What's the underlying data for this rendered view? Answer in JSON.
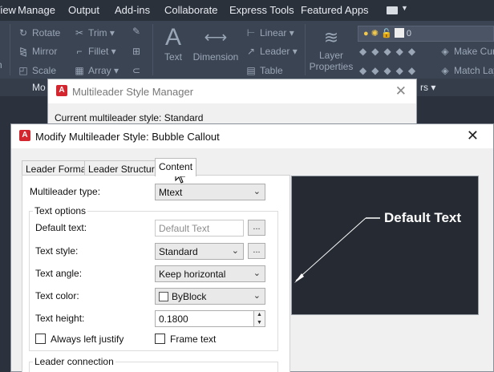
{
  "menubar": {
    "items": [
      "View",
      "Manage",
      "Output",
      "Add-ins",
      "Collaborate",
      "Express Tools",
      "Featured Apps"
    ]
  },
  "ribbon": {
    "modify_tools": [
      {
        "label": "Rotate",
        "icon": "rotate-icon"
      },
      {
        "label": "Mirror",
        "icon": "mirror-icon"
      },
      {
        "label": "Scale",
        "icon": "scale-icon"
      },
      {
        "label": "Trim",
        "icon": "trim-icon"
      },
      {
        "label": "Fillet",
        "icon": "fillet-icon"
      },
      {
        "label": "Array",
        "icon": "array-icon"
      }
    ],
    "left_cut_labels": [
      "h"
    ],
    "annotation": {
      "text_label": "Text",
      "dimension_label": "Dimension",
      "linear_label": "Linear",
      "leader_label": "Leader",
      "table_label": "Table"
    },
    "layer_properties_label": "Layer Properties",
    "layer_value": "0",
    "right_tools": [
      "Make Cur",
      "Match Lay"
    ],
    "panel_title_left": "Mo",
    "panel_title_right": "rs"
  },
  "manager_dialog": {
    "title": "Multileader Style Manager",
    "current_style_label": "Current multileader style: Standard"
  },
  "modify_dialog": {
    "title": "Modify Multileader Style: Bubble Callout",
    "tabs": [
      "Leader Format",
      "Leader Structure",
      "Content"
    ],
    "active_tab": "Content",
    "multileader_type_label": "Multileader type:",
    "multileader_type_value": "Mtext",
    "text_options": {
      "group_title": "Text options",
      "default_text_label": "Default text:",
      "default_text_value": "Default Text",
      "text_style_label": "Text style:",
      "text_style_value": "Standard",
      "text_angle_label": "Text angle:",
      "text_angle_value": "Keep horizontal",
      "text_color_label": "Text color:",
      "text_color_value": "ByBlock",
      "text_height_label": "Text height:",
      "text_height_value": "0.1800",
      "always_left_justify_label": "Always left justify",
      "frame_text_label": "Frame text",
      "ellipsis": "..."
    },
    "leader_connection_title": "Leader connection",
    "preview_text": "Default Text"
  },
  "colors": {
    "app_dark": "#2b313b",
    "ribbon": "#3b4453",
    "preview_bg": "#252a33",
    "autocad_red": "#d3262e"
  }
}
